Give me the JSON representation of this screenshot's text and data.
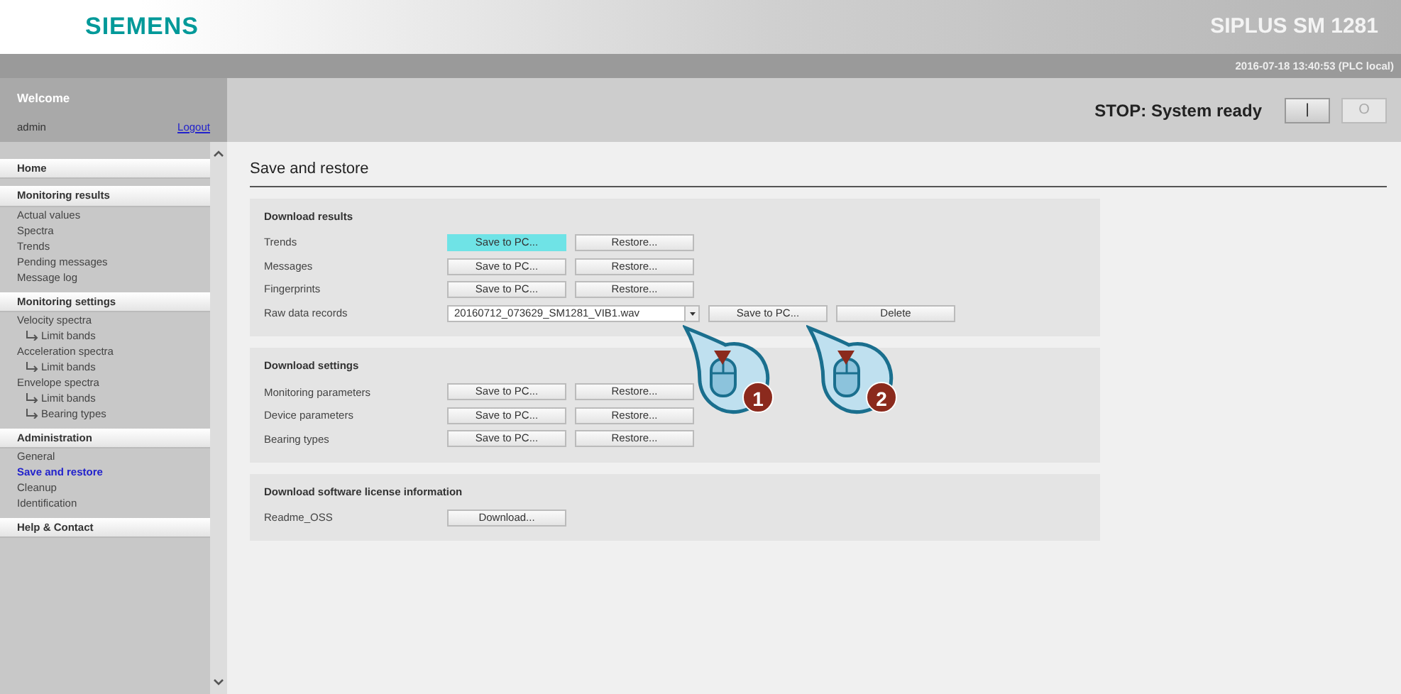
{
  "header": {
    "logo": "SIEMENS",
    "product": "SIPLUS SM 1281",
    "datetime": "2016-07-18 13:40:53 (PLC local)"
  },
  "user": {
    "welcome": "Welcome",
    "name": "admin",
    "logout": "Logout"
  },
  "status": {
    "text": "STOP: System ready",
    "buttons": [
      {
        "label": "|",
        "disabled": false
      },
      {
        "label": "O",
        "disabled": true
      }
    ]
  },
  "sidebar": {
    "groups": [
      {
        "title": "Home"
      },
      {
        "title": "Monitoring results",
        "items": [
          {
            "label": "Actual values",
            "selected": false
          },
          {
            "label": "Spectra",
            "selected": false
          },
          {
            "label": "Trends",
            "selected": false
          },
          {
            "label": "Pending messages",
            "selected": false
          },
          {
            "label": "Message log",
            "selected": false
          }
        ]
      },
      {
        "title": "Monitoring settings",
        "items": [
          {
            "label": "Velocity spectra",
            "selected": false,
            "children": [
              {
                "label": "Limit bands",
                "selected": false
              }
            ]
          },
          {
            "label": "Acceleration spectra",
            "selected": false,
            "children": [
              {
                "label": "Limit bands",
                "selected": false
              }
            ]
          },
          {
            "label": "Envelope spectra",
            "selected": false,
            "children": [
              {
                "label": "Limit bands",
                "selected": false
              },
              {
                "label": "Bearing types",
                "selected": false
              }
            ]
          }
        ]
      },
      {
        "title": "Administration",
        "items": [
          {
            "label": "General",
            "selected": false
          },
          {
            "label": "Save and restore",
            "selected": true
          },
          {
            "label": "Cleanup",
            "selected": false
          },
          {
            "label": "Identification",
            "selected": false
          }
        ]
      },
      {
        "title": "Help & Contact"
      }
    ]
  },
  "page_title": "Save and restore",
  "sections": [
    {
      "title": "Download results",
      "rows": [
        {
          "label": "Trends",
          "controls": [
            {
              "kind": "button",
              "label": "Save to PC...",
              "highlighted": true
            },
            {
              "kind": "button",
              "label": "Restore...",
              "highlighted": false
            }
          ]
        },
        {
          "label": "Messages",
          "controls": [
            {
              "kind": "button",
              "label": "Save to PC...",
              "highlighted": false
            },
            {
              "kind": "button",
              "label": "Restore...",
              "highlighted": false
            }
          ]
        },
        {
          "label": "Fingerprints",
          "controls": [
            {
              "kind": "button",
              "label": "Save to PC...",
              "highlighted": false
            },
            {
              "kind": "button",
              "label": "Restore...",
              "highlighted": false
            }
          ]
        },
        {
          "label": "Raw data records",
          "controls": [
            {
              "kind": "select",
              "value": "20160712_073629_SM1281_VIB1.wav"
            },
            {
              "kind": "button",
              "label": "Save to PC...",
              "highlighted": false
            },
            {
              "kind": "button",
              "label": "Delete",
              "highlighted": false
            }
          ]
        }
      ]
    },
    {
      "title": "Download settings",
      "rows": [
        {
          "label": "Monitoring parameters",
          "controls": [
            {
              "kind": "button",
              "label": "Save to PC...",
              "highlighted": false
            },
            {
              "kind": "button",
              "label": "Restore...",
              "highlighted": false
            }
          ]
        },
        {
          "label": "Device parameters",
          "controls": [
            {
              "kind": "button",
              "label": "Save to PC...",
              "highlighted": false
            },
            {
              "kind": "button",
              "label": "Restore...",
              "highlighted": false
            }
          ]
        },
        {
          "label": "Bearing types",
          "controls": [
            {
              "kind": "button",
              "label": "Save to PC...",
              "highlighted": false
            },
            {
              "kind": "button",
              "label": "Restore...",
              "highlighted": false
            }
          ]
        }
      ]
    },
    {
      "title": "Download software license information",
      "rows": [
        {
          "label": "Readme_OSS",
          "controls": [
            {
              "kind": "button",
              "label": "Download...",
              "highlighted": false
            }
          ]
        }
      ]
    }
  ],
  "callouts": [
    {
      "number": "1"
    },
    {
      "number": "2"
    }
  ]
}
